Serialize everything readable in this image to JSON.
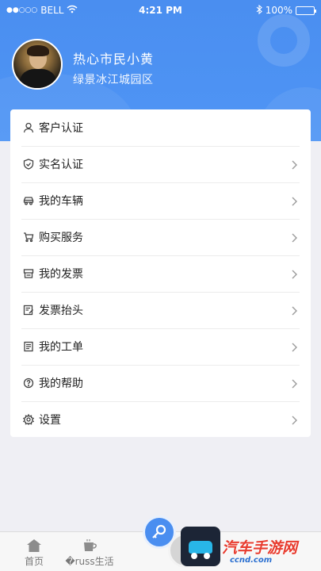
{
  "status_bar": {
    "carrier": "BELL",
    "time": "4:21 PM",
    "battery": "100%"
  },
  "profile": {
    "name": "热心市民小黄",
    "community": "绿景冰江城园区"
  },
  "menu": {
    "items": [
      {
        "label": "客户认证",
        "icon": "user-icon",
        "chevron": false
      },
      {
        "label": "实名认证",
        "icon": "shield-icon",
        "chevron": true
      },
      {
        "label": "我的车辆",
        "icon": "car-icon",
        "chevron": true
      },
      {
        "label": "购买服务",
        "icon": "cart-icon",
        "chevron": true
      },
      {
        "label": "我的发票",
        "icon": "printer-icon",
        "chevron": true
      },
      {
        "label": "发票抬头",
        "icon": "document-edit-icon",
        "chevron": true
      },
      {
        "label": "我的工单",
        "icon": "clipboard-icon",
        "chevron": true
      },
      {
        "label": "我的帮助",
        "icon": "help-icon",
        "chevron": true
      },
      {
        "label": "设置",
        "icon": "gear-icon",
        "chevron": true
      }
    ]
  },
  "tabbar": {
    "home_label": "首页",
    "life_label": "�russ生活"
  },
  "watermark": {
    "text": "汽车手游网",
    "sub": "ccnd.com"
  }
}
